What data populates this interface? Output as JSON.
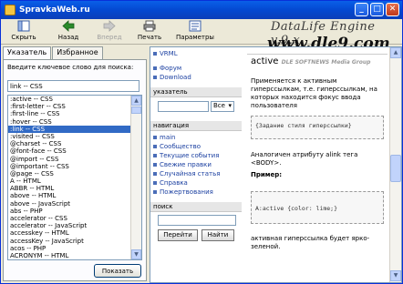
{
  "window": {
    "title": "SpravkaWeb.ru"
  },
  "toolbar": {
    "hide": "Скрыть",
    "back": "Назад",
    "forward": "Вперед",
    "print": "Печать",
    "params": "Параметры"
  },
  "logo": {
    "line1": "DataLife Engine v.9.x",
    "line2": "www.dle9.com"
  },
  "tabs": {
    "index": "Указатель",
    "favorites": "Избранное"
  },
  "search": {
    "prompt": "Введите ключевое слово для поиска:",
    "value": "link -- CSS"
  },
  "list_items": [
    ":active -- CSS",
    ":first-letter -- CSS",
    ":first-line -- CSS",
    ":hover -- CSS",
    ":link -- CSS",
    ":visited -- CSS",
    "@charset -- CSS",
    "@font-face -- CSS",
    "@import -- CSS",
    "@important -- CSS",
    "@page -- CSS",
    "A -- HTML",
    "ABBR -- HTML",
    "above -- HTML",
    "above -- JavaScript",
    "abs -- PHP",
    "accelerator -- CSS",
    "accelerator -- JavaScript",
    "accesskey -- HTML",
    "accessKey -- JavaScript",
    "acos -- PHP",
    "ACRONYM -- HTML"
  ],
  "show_button": "Показать",
  "nav": {
    "top_links": [
      "VRML",
      "Форум",
      "Download"
    ],
    "pointer_head": "указатель",
    "pointer_select": "Все",
    "navigation_head": "навигация",
    "navigation_links": [
      "main",
      "Сообщество",
      "Текущие события",
      "Свежие правки",
      "Случайная статья",
      "Справка",
      "Пожертвования"
    ],
    "search_head": "поиск",
    "go_button": "Перейти",
    "find_button": "Найти"
  },
  "article": {
    "heading": "active",
    "overlay": "DLE SOFTNEWS Media Group",
    "p1": "Применяется к активным гиперссылкам, т.е. гиперссылкам, на которых находится фокус ввода пользователя",
    "code1": "{Задание стиля гиперссылки}",
    "p2": "Аналогичен атрибуту alink тега <BODY>.",
    "example_label": "Пример:",
    "code2": "A:active {color: lime;}",
    "p3": "активная гиперссылка будет ярко-зеленой."
  }
}
